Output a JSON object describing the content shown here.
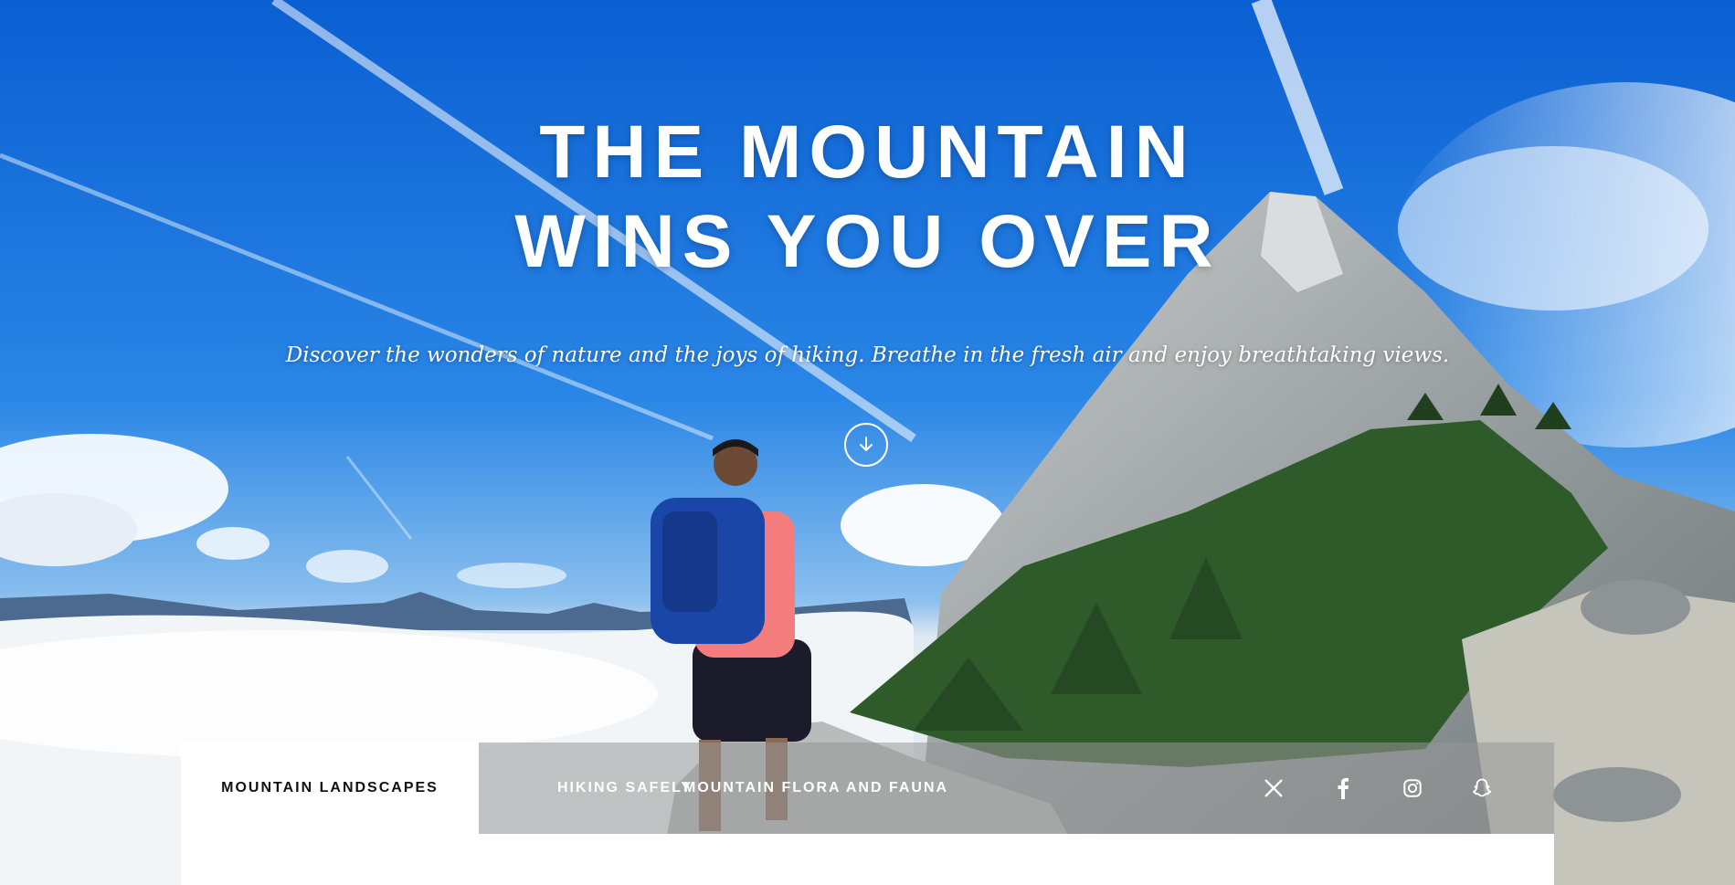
{
  "hero": {
    "title_line1": "THE MOUNTAIN",
    "title_line2": "WINS YOU OVER",
    "tagline": "Discover the wonders of nature and the joys of hiking. Breathe in the fresh air and enjoy breathtaking views.",
    "scroll_icon": "arrow-down-circle-icon"
  },
  "nav": {
    "tabs": [
      {
        "label": "MOUNTAIN LANDSCAPES",
        "active": true
      },
      {
        "label": "HIKING SAFELY",
        "active": false
      },
      {
        "label": "MOUNTAIN FLORA AND FAUNA",
        "active": false
      }
    ],
    "social": [
      "x-icon",
      "facebook-icon",
      "instagram-icon",
      "snapchat-icon"
    ]
  },
  "colors": {
    "sky": "#1f7fe6",
    "nav_bg": "#969696",
    "active_tab_bg": "#ffffff",
    "text": "#ffffff"
  }
}
